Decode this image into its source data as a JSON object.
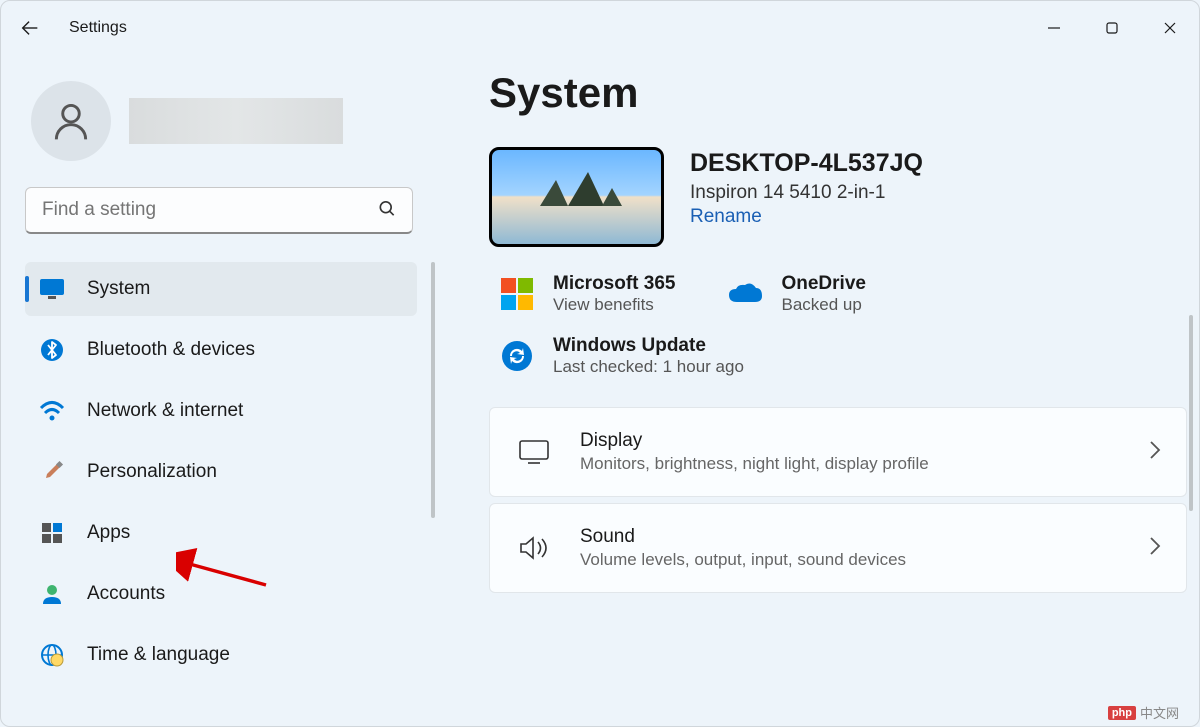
{
  "titlebar": {
    "title": "Settings"
  },
  "search": {
    "placeholder": "Find a setting"
  },
  "nav": {
    "items": [
      {
        "label": "System",
        "icon": "monitor-icon",
        "active": true
      },
      {
        "label": "Bluetooth & devices",
        "icon": "bluetooth-icon",
        "active": false
      },
      {
        "label": "Network & internet",
        "icon": "wifi-icon",
        "active": false
      },
      {
        "label": "Personalization",
        "icon": "brush-icon",
        "active": false
      },
      {
        "label": "Apps",
        "icon": "apps-icon",
        "active": false
      },
      {
        "label": "Accounts",
        "icon": "accounts-icon",
        "active": false
      },
      {
        "label": "Time & language",
        "icon": "time-language-icon",
        "active": false
      }
    ]
  },
  "main": {
    "heading": "System",
    "device": {
      "name": "DESKTOP-4L537JQ",
      "model": "Inspiron 14 5410 2-in-1",
      "rename": "Rename"
    },
    "cards": {
      "m365": {
        "title": "Microsoft 365",
        "sub": "View benefits"
      },
      "onedrive": {
        "title": "OneDrive",
        "sub": "Backed up"
      },
      "update": {
        "title": "Windows Update",
        "sub": "Last checked: 1 hour ago"
      }
    },
    "settings": [
      {
        "title": "Display",
        "sub": "Monitors, brightness, night light, display profile",
        "icon": "display-icon"
      },
      {
        "title": "Sound",
        "sub": "Volume levels, output, input, sound devices",
        "icon": "sound-icon"
      }
    ]
  },
  "watermark": {
    "logo": "php",
    "text": "中文网"
  }
}
